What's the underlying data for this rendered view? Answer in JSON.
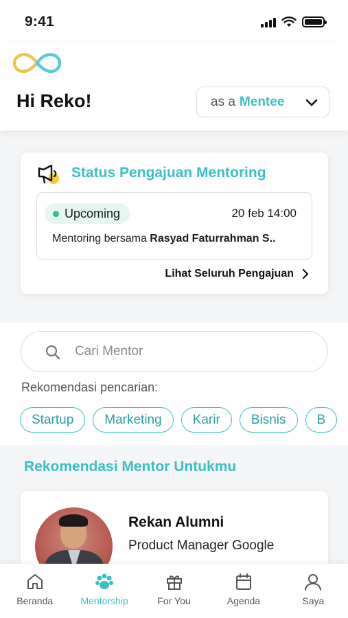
{
  "status_bar": {
    "time": "9:41"
  },
  "header": {
    "greeting": "Hi Reko!",
    "role_prefix": "as a",
    "role_value": "Mentee"
  },
  "status_card": {
    "title": "Status Pengajuan Mentoring",
    "session": {
      "badge": "Upcoming",
      "date": "20 feb 14:00",
      "desc_prefix": "Mentoring bersama ",
      "mentor_name": "Rasyad Faturrahman S.."
    },
    "see_all": "Lihat Seluruh Pengajuan"
  },
  "search": {
    "placeholder": "Cari Mentor",
    "recommend_label": "Rekomendasi pencarian:",
    "chips": [
      "Startup",
      "Marketing",
      "Karir",
      "Bisnis",
      "B"
    ]
  },
  "mentor_section": {
    "heading": "Rekomendasi Mentor Untukmu",
    "card": {
      "name": "Rekan Alumni",
      "role": "Product Manager Google"
    }
  },
  "bottom_nav": {
    "items": [
      {
        "label": "Beranda",
        "icon": "home-icon"
      },
      {
        "label": "Mentorship",
        "icon": "paw-icon",
        "active": true
      },
      {
        "label": "For You",
        "icon": "gift-icon"
      },
      {
        "label": "Agenda",
        "icon": "calendar-icon"
      },
      {
        "label": "Saya",
        "icon": "user-icon"
      }
    ]
  },
  "colors": {
    "accent": "#3bbfc4",
    "upcoming_dot": "#2fbf8f",
    "badge_bg": "#e6f6f1"
  }
}
